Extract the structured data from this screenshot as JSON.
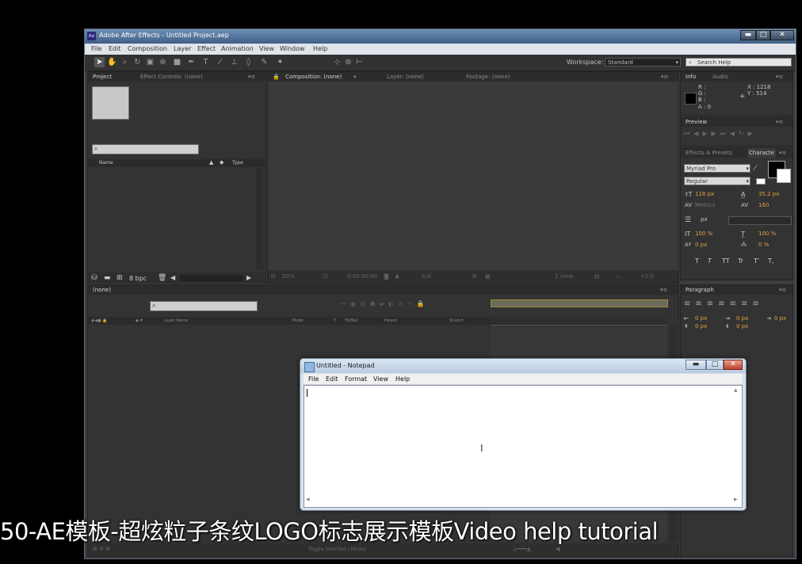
{
  "window": {
    "title": "Adobe After Effects - Untitled Project.aep",
    "app_icon": "Ae",
    "minimize": "▬",
    "maximize": "□",
    "close": "✕"
  },
  "menubar": [
    "File",
    "Edit",
    "Composition",
    "Layer",
    "Effect",
    "Animation",
    "View",
    "Window",
    "Help"
  ],
  "toolbar": {
    "workspace_label": "Workspace:",
    "workspace_value": "Standard",
    "search_placeholder": "Search Help"
  },
  "project_panel": {
    "tabs": [
      "Project",
      "Effect Controls: (none)"
    ],
    "col_name": "Name",
    "col_type": "Type",
    "bpc": "8 bpc"
  },
  "comp_panel": {
    "tabs": [
      "Composition: (none)",
      "Layer: (none)",
      "Footage: (none)"
    ],
    "zoom": "50%",
    "timecode": "0:00:00:00",
    "resolution": "Full",
    "view": "1 View",
    "exposure": "+0.0"
  },
  "info_panel": {
    "tabs": [
      "Info",
      "Audio"
    ],
    "r": "R :",
    "g": "G :",
    "b": "B :",
    "a": "A : 0",
    "x": "X : 1218",
    "y": "Y : 514"
  },
  "preview_panel": {
    "tab": "Preview"
  },
  "character_panel": {
    "tabs": [
      "Effects & Presets",
      "Characte"
    ],
    "font": "Myriad Pro",
    "style": "Regular",
    "size": "118 px",
    "leading": "35.2 px",
    "kerning": "Metrics",
    "tracking": "160",
    "stroke": "px",
    "vscale": "100 %",
    "hscale": "100 %",
    "baseline": "0 px",
    "tsume": "0 %",
    "styles": [
      "T",
      "T",
      "TT",
      "Tr",
      "T'",
      "T,"
    ]
  },
  "paragraph_panel": {
    "tab": "Paragraph",
    "indent_left": "0 px",
    "indent_right": "0 px",
    "indent_first": "0 px",
    "space_before": "0 px",
    "space_after": "0 px"
  },
  "timeline_panel": {
    "tab": "(none)",
    "cols": [
      "Layer Name",
      "Mode",
      "T",
      "TrkMat",
      "Parent",
      "Stretch"
    ],
    "toggle": "Toggle Switches / Modes"
  },
  "notepad": {
    "title": "Untitled - Notepad",
    "menu": [
      "File",
      "Edit",
      "Format",
      "View",
      "Help"
    ]
  },
  "caption": "50-AE模板-超炫粒子条纹LOGO标志展示模板Video help tutorial",
  "colors": {
    "title_bar": "#4f73a0",
    "panel_bg": "#333333",
    "accent_orange": "#e0a040"
  }
}
